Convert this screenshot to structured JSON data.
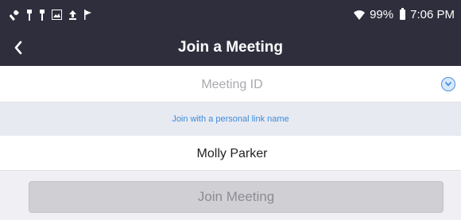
{
  "status_bar": {
    "left_icons": [
      "wrench-icon",
      "usb-icon",
      "usb-icon",
      "image-icon",
      "upload-icon",
      "flag-icon"
    ],
    "wifi_icon": "wifi-icon",
    "battery_percent": "99%",
    "battery_icon": "battery-icon",
    "time": "7:06 PM"
  },
  "nav": {
    "back_icon": "chevron-left-icon",
    "title": "Join a Meeting"
  },
  "meeting_id": {
    "placeholder": "Meeting ID",
    "value": "",
    "dropdown_icon": "chevron-down-icon"
  },
  "personal_link": {
    "label": "Join with a personal link name"
  },
  "display_name": {
    "value": "Molly Parker"
  },
  "join_button": {
    "label": "Join Meeting",
    "enabled": false
  },
  "colors": {
    "header_bg": "#2e2e3d",
    "link": "#3d8bd9",
    "disabled_button": "#cfcfd4",
    "page_bg": "#efeff4"
  }
}
